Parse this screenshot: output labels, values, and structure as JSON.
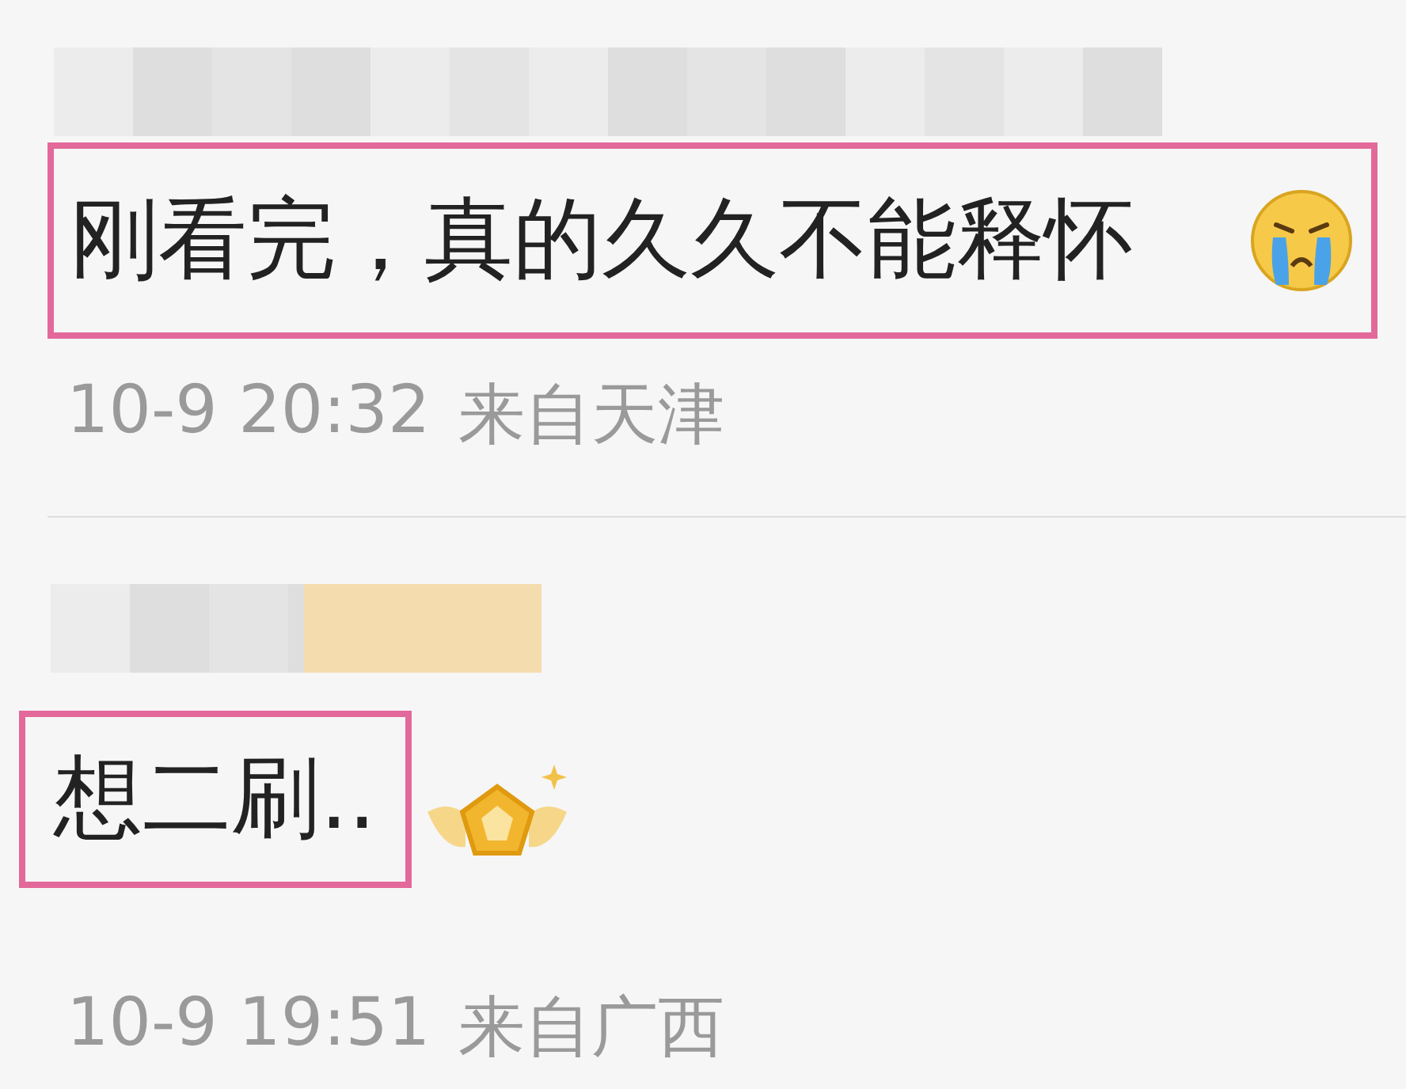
{
  "comments": [
    {
      "text": "刚看完，真的久久不能释怀",
      "highlighted": true,
      "kind": "crying",
      "date": "10-9 20:32",
      "location": "来自天津"
    },
    {
      "text": "想二刷..",
      "highlighted": true,
      "kind": "badge",
      "date": "10-9 19:51",
      "location": "来自广西"
    }
  ]
}
